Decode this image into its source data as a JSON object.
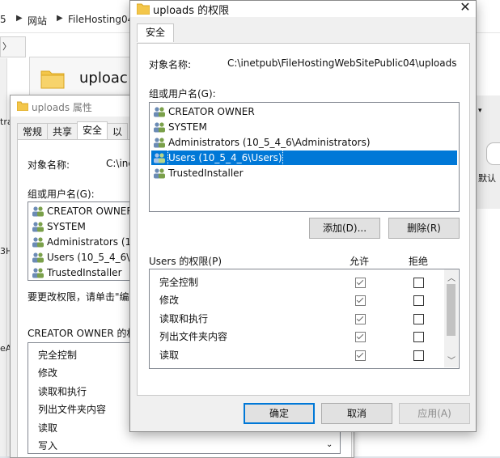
{
  "explorer": {
    "breadcrumb": [
      "5",
      "网站",
      "FileHosting04"
    ],
    "folder_title_partial": "uploac",
    "left_fragments": [
      "〉",
      "tra",
      "3H",
      "eA"
    ],
    "right_fragment": "默认",
    "icons": {
      "folder": "folder-icon",
      "drive": "drive-icon"
    }
  },
  "props_window": {
    "title": "uploads 属性",
    "tabs": [
      "常规",
      "共享",
      "安全",
      "以"
    ],
    "object_label": "对象名称:",
    "object_value": "C:\\ine",
    "group_label": "组或用户名(G):",
    "users": [
      "CREATOR OWNER",
      "SYSTEM",
      "Administrators (10",
      "Users (10_5_4_6\\U",
      "TrustedInstaller"
    ],
    "hint": "要更改权限，请单击\"编",
    "perm_header": "CREATOR OWNER 的权",
    "perms": [
      "完全控制",
      "修改",
      "读取和执行",
      "列出文件夹内容",
      "读取",
      "写入"
    ]
  },
  "perm_dialog": {
    "title": "uploads 的权限",
    "tab": "安全",
    "object_label": "对象名称:",
    "object_value": "C:\\inetpub\\FileHostingWebSitePublic04\\uploads",
    "group_label": "组或用户名(G):",
    "users": [
      {
        "name": "CREATOR OWNER",
        "selected": false
      },
      {
        "name": "SYSTEM",
        "selected": false
      },
      {
        "name": "Administrators (10_5_4_6\\Administrators)",
        "selected": false
      },
      {
        "name": "Users (10_5_4_6\\Users)",
        "selected": true
      },
      {
        "name": "TrustedInstaller",
        "selected": false
      }
    ],
    "add_button": "添加(D)...",
    "remove_button": "删除(R)",
    "perm_header": "Users 的权限(P)",
    "allow_header": "允许",
    "deny_header": "拒绝",
    "permissions": [
      {
        "name": "完全控制",
        "allow": true,
        "deny": false
      },
      {
        "name": "修改",
        "allow": true,
        "deny": false
      },
      {
        "name": "读取和执行",
        "allow": true,
        "deny": false
      },
      {
        "name": "列出文件夹内容",
        "allow": true,
        "deny": false
      },
      {
        "name": "读取",
        "allow": true,
        "deny": false
      }
    ],
    "ok_button": "确定",
    "cancel_button": "取消",
    "apply_button": "应用(A)"
  },
  "colors": {
    "selection": "#0078d7",
    "dialog_bg": "#f0f0f0",
    "folder": "#f3c64a"
  }
}
